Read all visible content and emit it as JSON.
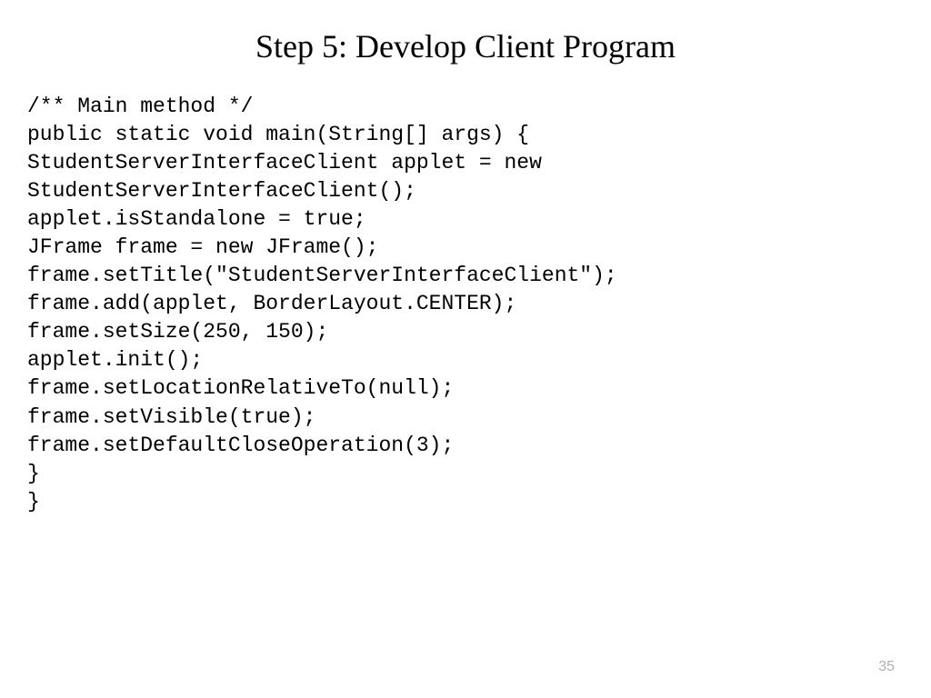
{
  "slide": {
    "title": "Step 5: Develop Client Program",
    "code": "/** Main method */\npublic static void main(String[] args) {\nStudentServerInterfaceClient applet = new\nStudentServerInterfaceClient();\napplet.isStandalone = true;\nJFrame frame = new JFrame();\nframe.setTitle(\"StudentServerInterfaceClient\");\nframe.add(applet, BorderLayout.CENTER);\nframe.setSize(250, 150);\napplet.init();\nframe.setLocationRelativeTo(null);\nframe.setVisible(true);\nframe.setDefaultCloseOperation(3);\n}\n}",
    "page_number": "35"
  }
}
